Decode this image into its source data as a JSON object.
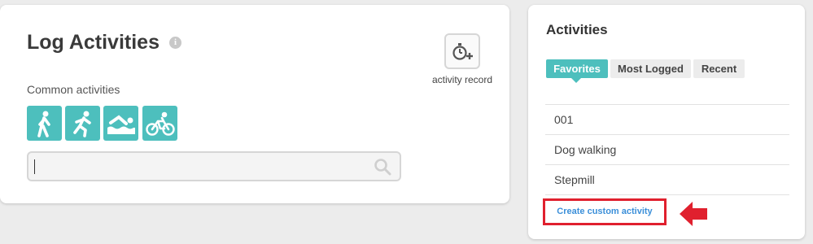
{
  "log": {
    "title": "Log Activities",
    "info_icon": "info-icon",
    "record_label": "activity record",
    "common_label": "Common activities",
    "icons": [
      "walking-icon",
      "running-icon",
      "swimming-icon",
      "cycling-icon"
    ],
    "search": {
      "value": "",
      "placeholder": ""
    }
  },
  "activities": {
    "title": "Activities",
    "tabs": [
      {
        "label": "Favorites",
        "active": true
      },
      {
        "label": "Most Logged",
        "active": false
      },
      {
        "label": "Recent",
        "active": false
      }
    ],
    "items": [
      "001",
      "Dog walking",
      "Stepmill"
    ],
    "create_link": "Create custom activity"
  },
  "colors": {
    "accent": "#4dbfbd",
    "highlight": "#e0202e",
    "link": "#3b8fd9"
  }
}
